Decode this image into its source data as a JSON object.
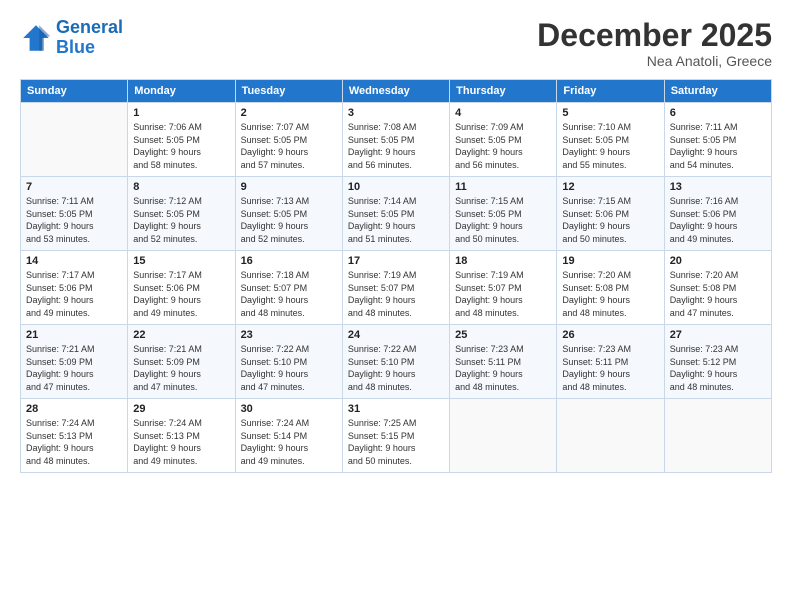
{
  "logo": {
    "line1": "General",
    "line2": "Blue"
  },
  "title": "December 2025",
  "location": "Nea Anatoli, Greece",
  "days_header": [
    "Sunday",
    "Monday",
    "Tuesday",
    "Wednesday",
    "Thursday",
    "Friday",
    "Saturday"
  ],
  "weeks": [
    [
      {
        "num": "",
        "info": ""
      },
      {
        "num": "1",
        "info": "Sunrise: 7:06 AM\nSunset: 5:05 PM\nDaylight: 9 hours\nand 58 minutes."
      },
      {
        "num": "2",
        "info": "Sunrise: 7:07 AM\nSunset: 5:05 PM\nDaylight: 9 hours\nand 57 minutes."
      },
      {
        "num": "3",
        "info": "Sunrise: 7:08 AM\nSunset: 5:05 PM\nDaylight: 9 hours\nand 56 minutes."
      },
      {
        "num": "4",
        "info": "Sunrise: 7:09 AM\nSunset: 5:05 PM\nDaylight: 9 hours\nand 56 minutes."
      },
      {
        "num": "5",
        "info": "Sunrise: 7:10 AM\nSunset: 5:05 PM\nDaylight: 9 hours\nand 55 minutes."
      },
      {
        "num": "6",
        "info": "Sunrise: 7:11 AM\nSunset: 5:05 PM\nDaylight: 9 hours\nand 54 minutes."
      }
    ],
    [
      {
        "num": "7",
        "info": "Sunrise: 7:11 AM\nSunset: 5:05 PM\nDaylight: 9 hours\nand 53 minutes."
      },
      {
        "num": "8",
        "info": "Sunrise: 7:12 AM\nSunset: 5:05 PM\nDaylight: 9 hours\nand 52 minutes."
      },
      {
        "num": "9",
        "info": "Sunrise: 7:13 AM\nSunset: 5:05 PM\nDaylight: 9 hours\nand 52 minutes."
      },
      {
        "num": "10",
        "info": "Sunrise: 7:14 AM\nSunset: 5:05 PM\nDaylight: 9 hours\nand 51 minutes."
      },
      {
        "num": "11",
        "info": "Sunrise: 7:15 AM\nSunset: 5:05 PM\nDaylight: 9 hours\nand 50 minutes."
      },
      {
        "num": "12",
        "info": "Sunrise: 7:15 AM\nSunset: 5:06 PM\nDaylight: 9 hours\nand 50 minutes."
      },
      {
        "num": "13",
        "info": "Sunrise: 7:16 AM\nSunset: 5:06 PM\nDaylight: 9 hours\nand 49 minutes."
      }
    ],
    [
      {
        "num": "14",
        "info": "Sunrise: 7:17 AM\nSunset: 5:06 PM\nDaylight: 9 hours\nand 49 minutes."
      },
      {
        "num": "15",
        "info": "Sunrise: 7:17 AM\nSunset: 5:06 PM\nDaylight: 9 hours\nand 49 minutes."
      },
      {
        "num": "16",
        "info": "Sunrise: 7:18 AM\nSunset: 5:07 PM\nDaylight: 9 hours\nand 48 minutes."
      },
      {
        "num": "17",
        "info": "Sunrise: 7:19 AM\nSunset: 5:07 PM\nDaylight: 9 hours\nand 48 minutes."
      },
      {
        "num": "18",
        "info": "Sunrise: 7:19 AM\nSunset: 5:07 PM\nDaylight: 9 hours\nand 48 minutes."
      },
      {
        "num": "19",
        "info": "Sunrise: 7:20 AM\nSunset: 5:08 PM\nDaylight: 9 hours\nand 48 minutes."
      },
      {
        "num": "20",
        "info": "Sunrise: 7:20 AM\nSunset: 5:08 PM\nDaylight: 9 hours\nand 47 minutes."
      }
    ],
    [
      {
        "num": "21",
        "info": "Sunrise: 7:21 AM\nSunset: 5:09 PM\nDaylight: 9 hours\nand 47 minutes."
      },
      {
        "num": "22",
        "info": "Sunrise: 7:21 AM\nSunset: 5:09 PM\nDaylight: 9 hours\nand 47 minutes."
      },
      {
        "num": "23",
        "info": "Sunrise: 7:22 AM\nSunset: 5:10 PM\nDaylight: 9 hours\nand 47 minutes."
      },
      {
        "num": "24",
        "info": "Sunrise: 7:22 AM\nSunset: 5:10 PM\nDaylight: 9 hours\nand 48 minutes."
      },
      {
        "num": "25",
        "info": "Sunrise: 7:23 AM\nSunset: 5:11 PM\nDaylight: 9 hours\nand 48 minutes."
      },
      {
        "num": "26",
        "info": "Sunrise: 7:23 AM\nSunset: 5:11 PM\nDaylight: 9 hours\nand 48 minutes."
      },
      {
        "num": "27",
        "info": "Sunrise: 7:23 AM\nSunset: 5:12 PM\nDaylight: 9 hours\nand 48 minutes."
      }
    ],
    [
      {
        "num": "28",
        "info": "Sunrise: 7:24 AM\nSunset: 5:13 PM\nDaylight: 9 hours\nand 48 minutes."
      },
      {
        "num": "29",
        "info": "Sunrise: 7:24 AM\nSunset: 5:13 PM\nDaylight: 9 hours\nand 49 minutes."
      },
      {
        "num": "30",
        "info": "Sunrise: 7:24 AM\nSunset: 5:14 PM\nDaylight: 9 hours\nand 49 minutes."
      },
      {
        "num": "31",
        "info": "Sunrise: 7:25 AM\nSunset: 5:15 PM\nDaylight: 9 hours\nand 50 minutes."
      },
      {
        "num": "",
        "info": ""
      },
      {
        "num": "",
        "info": ""
      },
      {
        "num": "",
        "info": ""
      }
    ]
  ]
}
